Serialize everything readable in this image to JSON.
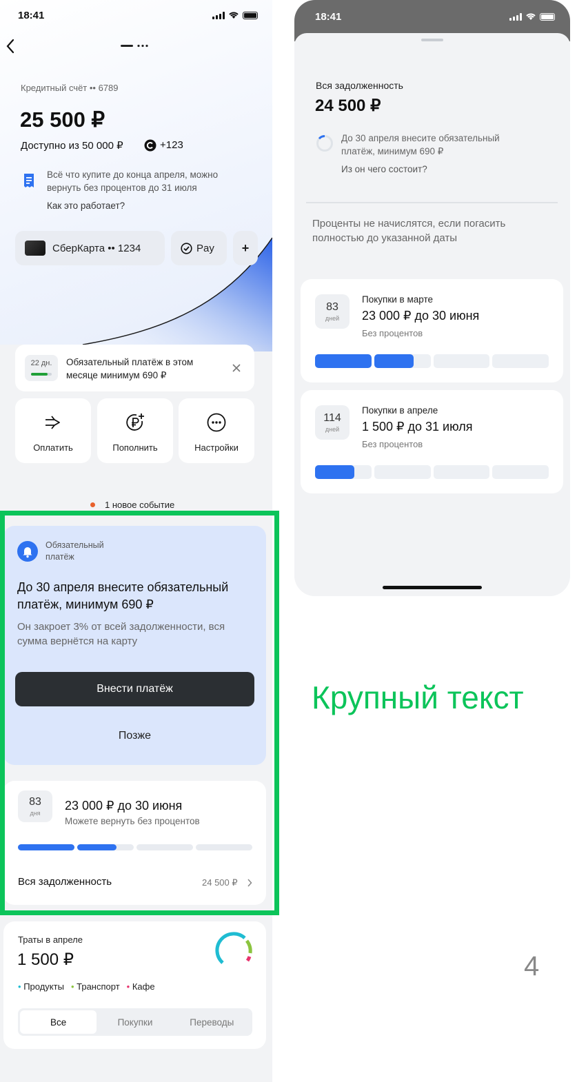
{
  "left": {
    "status": {
      "time": "18:41"
    },
    "account": {
      "label": "Кредитный счёт •• 6789",
      "amount": "25 500 ₽",
      "available": "Доступно из 50 000 ₽",
      "bonus": "+123"
    },
    "promo": {
      "text": "Всё что купите до конца апреля, можно вернуть без процентов до 31 июля",
      "link": "Как это работает?"
    },
    "cards": {
      "card_label": "СберКарта •• 1234",
      "pay_label": "Pay",
      "add_label": "+"
    },
    "notice": {
      "days": "22 дн.",
      "text": "Обязательный платёж в этом месяце минимум 690 ₽"
    },
    "actions": [
      {
        "label": "Оплатить",
        "icon": "arrow-right-icon"
      },
      {
        "label": "Пополнить",
        "icon": "ruble-plus-icon"
      },
      {
        "label": "Настройки",
        "icon": "more-dots-icon"
      }
    ],
    "events": {
      "text": "1 новое событие"
    },
    "mandatory": {
      "tag": "Обязательный платёж",
      "title": "До 30 апреля внесите обязательный платёж, минимум 690 ₽",
      "subtitle": "Он закроет 3% от всей задолженности, вся сумма вернётся на карту",
      "pay_button": "Внести платёж",
      "later_button": "Позже"
    },
    "debt": {
      "days": "83",
      "days_unit": "дня",
      "title": "23 000 ₽ до 30 июня",
      "subtitle": "Можете вернуть без процентов",
      "progress": [
        1,
        0.7,
        0,
        0
      ],
      "total_label": "Вся задолженность",
      "total_value": "24 500 ₽"
    },
    "spending": {
      "title": "Траты в апреле",
      "amount": "1 500 ₽",
      "legend": [
        {
          "label": "Продукты",
          "color": "#1fbcd2"
        },
        {
          "label": "Транспорт",
          "color": "#8bc43f"
        },
        {
          "label": "Кафе",
          "color": "#e8336d"
        }
      ],
      "tabs": [
        "Все",
        "Покупки",
        "Переводы"
      ]
    }
  },
  "right": {
    "status": {
      "time": "18:41"
    },
    "total": {
      "label": "Вся задолженность",
      "amount": "24 500 ₽"
    },
    "reminder": {
      "text": "До 30 апреля внесите обязательный платёж, минимум 690 ₽",
      "link": "Из он чего состоит?"
    },
    "note": "Проценты не начислятся, если погасить полностью до указанной даты",
    "items": [
      {
        "days": "83",
        "unit": "дней",
        "title": "Покупки в марте",
        "amount": "23 000 ₽ до 30 июня",
        "sub": "Без процентов",
        "progress": [
          1,
          0.7,
          0,
          0
        ]
      },
      {
        "days": "114",
        "unit": "дней",
        "title": "Покупки в апреле",
        "amount": "1 500 ₽ до 31 июля",
        "sub": "Без процентов",
        "progress": [
          0.7,
          0,
          0,
          0
        ]
      }
    ]
  },
  "caption": "Крупный текст",
  "page_number": "4",
  "colors": {
    "accent": "#2e72f0",
    "highlight": "#0cc45a",
    "dark_button": "#2b2f33",
    "mandatory_bg": "#dbe6fc"
  }
}
